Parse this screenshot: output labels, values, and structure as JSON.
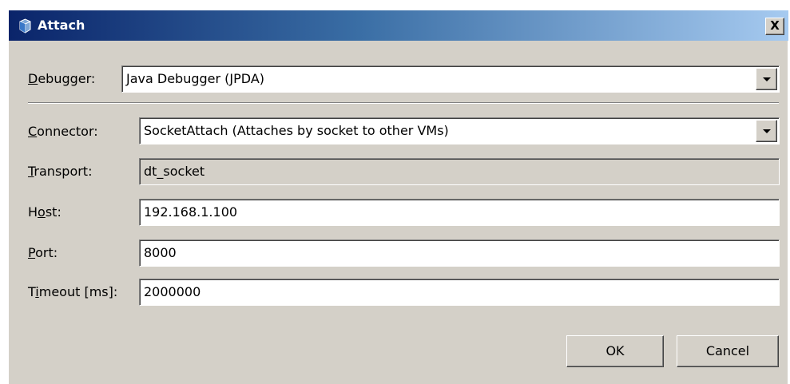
{
  "window": {
    "title": "Attach",
    "close_glyph": "X"
  },
  "debugger": {
    "label_mnemonic": "D",
    "label_rest": "ebugger:",
    "value": "Java Debugger (JPDA)"
  },
  "connector": {
    "label_mnemonic": "C",
    "label_rest": "onnector:",
    "value": "SocketAttach (Attaches by socket to other VMs)"
  },
  "transport": {
    "label_mnemonic": "T",
    "label_rest": "ransport:",
    "value": "dt_socket"
  },
  "host": {
    "label_pre": "H",
    "label_mnemonic": "o",
    "label_rest": "st:",
    "value": "192.168.1.100"
  },
  "port": {
    "label_mnemonic": "P",
    "label_rest": "ort:",
    "value": "8000"
  },
  "timeout": {
    "label_pre": "T",
    "label_mnemonic": "i",
    "label_rest": "meout [ms]:",
    "value": "2000000"
  },
  "buttons": {
    "ok_label": "OK",
    "cancel_label": "Cancel"
  },
  "colors": {
    "title_gradient_start": "#0a246a",
    "title_gradient_end": "#a6caf0",
    "dialog_background": "#d4d0c8"
  },
  "icons": {
    "app": "java-cup-icon",
    "close": "close-icon",
    "dropdown": "chevron-down-icon"
  }
}
